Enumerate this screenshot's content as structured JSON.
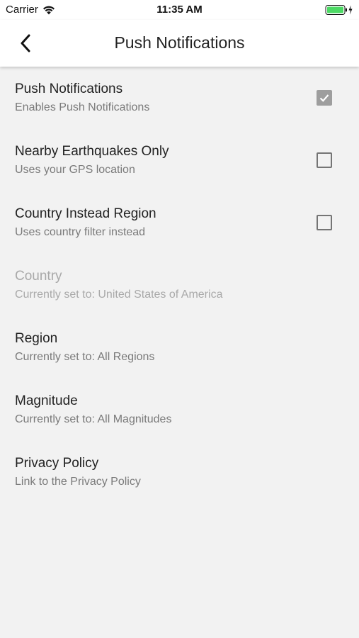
{
  "status_bar": {
    "carrier": "Carrier",
    "time": "11:35 AM",
    "wifi_icon": "wifi-icon",
    "battery_icon": "battery-charging-icon",
    "battery_color": "#4cd964"
  },
  "nav": {
    "title": "Push Notifications",
    "back_icon": "chevron-left-icon"
  },
  "settings": [
    {
      "title": "Push Notifications",
      "subtitle": "Enables Push Notifications",
      "checkbox": true,
      "checked": true
    },
    {
      "title": "Nearby Earthquakes Only",
      "subtitle": "Uses your GPS location",
      "checkbox": true,
      "checked": false
    },
    {
      "title": "Country Instead Region",
      "subtitle": "Uses country filter instead",
      "checkbox": true,
      "checked": false
    },
    {
      "title": "Country",
      "subtitle": "Currently set to: United States of America",
      "disabled": true
    },
    {
      "title": "Region",
      "subtitle": "Currently set to: All Regions"
    },
    {
      "title": "Magnitude",
      "subtitle": "Currently set to: All Magnitudes"
    },
    {
      "title": "Privacy Policy",
      "subtitle": "Link to the Privacy Policy"
    }
  ],
  "colors": {
    "background": "#f2f2f2",
    "header": "#ffffff",
    "checkbox_checked": "#9e9e9e",
    "checkbox_border": "#757575",
    "subtitle": "#7a7a7a",
    "disabled_text": "#a9a9a9"
  }
}
